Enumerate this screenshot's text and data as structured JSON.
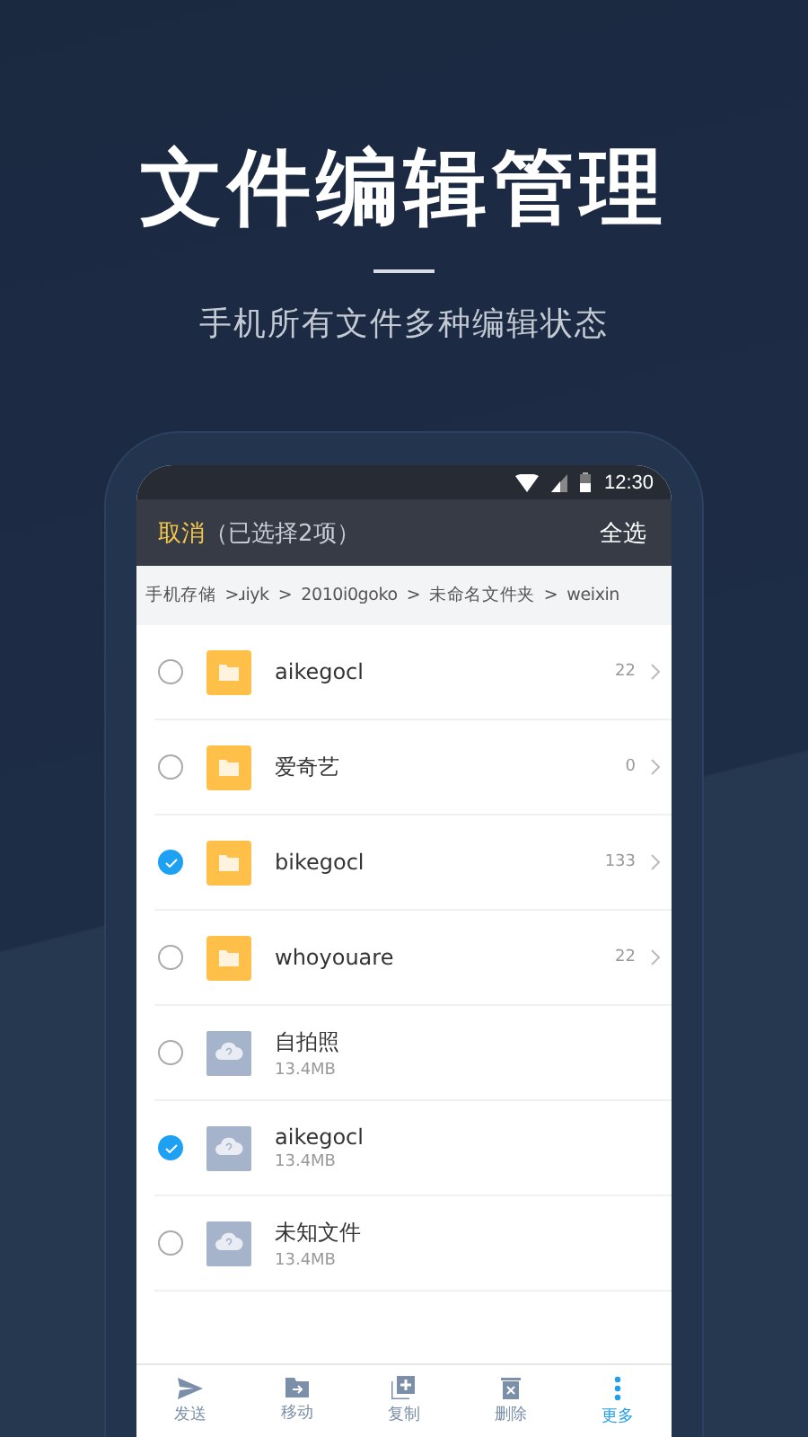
{
  "headline": {
    "title": "文件编辑管理",
    "subtitle": "手机所有文件多种编辑状态"
  },
  "status_bar": {
    "time": "12:30"
  },
  "title_bar": {
    "cancel": "取消",
    "selection": "（已选择2项）",
    "select_all": "全选"
  },
  "breadcrumb": [
    "手机存储",
    ">ɹiyk",
    ">",
    "2010i0goko",
    ">",
    "未命名文件夹",
    ">",
    "weixin"
  ],
  "rows": [
    {
      "kind": "folder",
      "name": "aikegocl",
      "count": "22",
      "checked": false
    },
    {
      "kind": "folder",
      "name": "爱奇艺",
      "count": "0",
      "checked": false
    },
    {
      "kind": "folder",
      "name": "bikegocl",
      "count": "133",
      "checked": true
    },
    {
      "kind": "folder",
      "name": "whoyouare",
      "count": "22",
      "checked": false
    },
    {
      "kind": "file",
      "name": "自拍照",
      "size": "13.4MB",
      "checked": false
    },
    {
      "kind": "file",
      "name": "aikegocl",
      "size": "13.4MB",
      "checked": true
    },
    {
      "kind": "file",
      "name": "未知文件",
      "size": "13.4MB",
      "checked": false
    }
  ],
  "toolbar": [
    {
      "kind": "send",
      "label": "发送",
      "selected": false
    },
    {
      "kind": "move",
      "label": "移动",
      "selected": false
    },
    {
      "kind": "copy",
      "label": "复制",
      "selected": false
    },
    {
      "kind": "delete",
      "label": "删除",
      "selected": false
    },
    {
      "kind": "more",
      "label": "更多",
      "selected": true
    }
  ]
}
